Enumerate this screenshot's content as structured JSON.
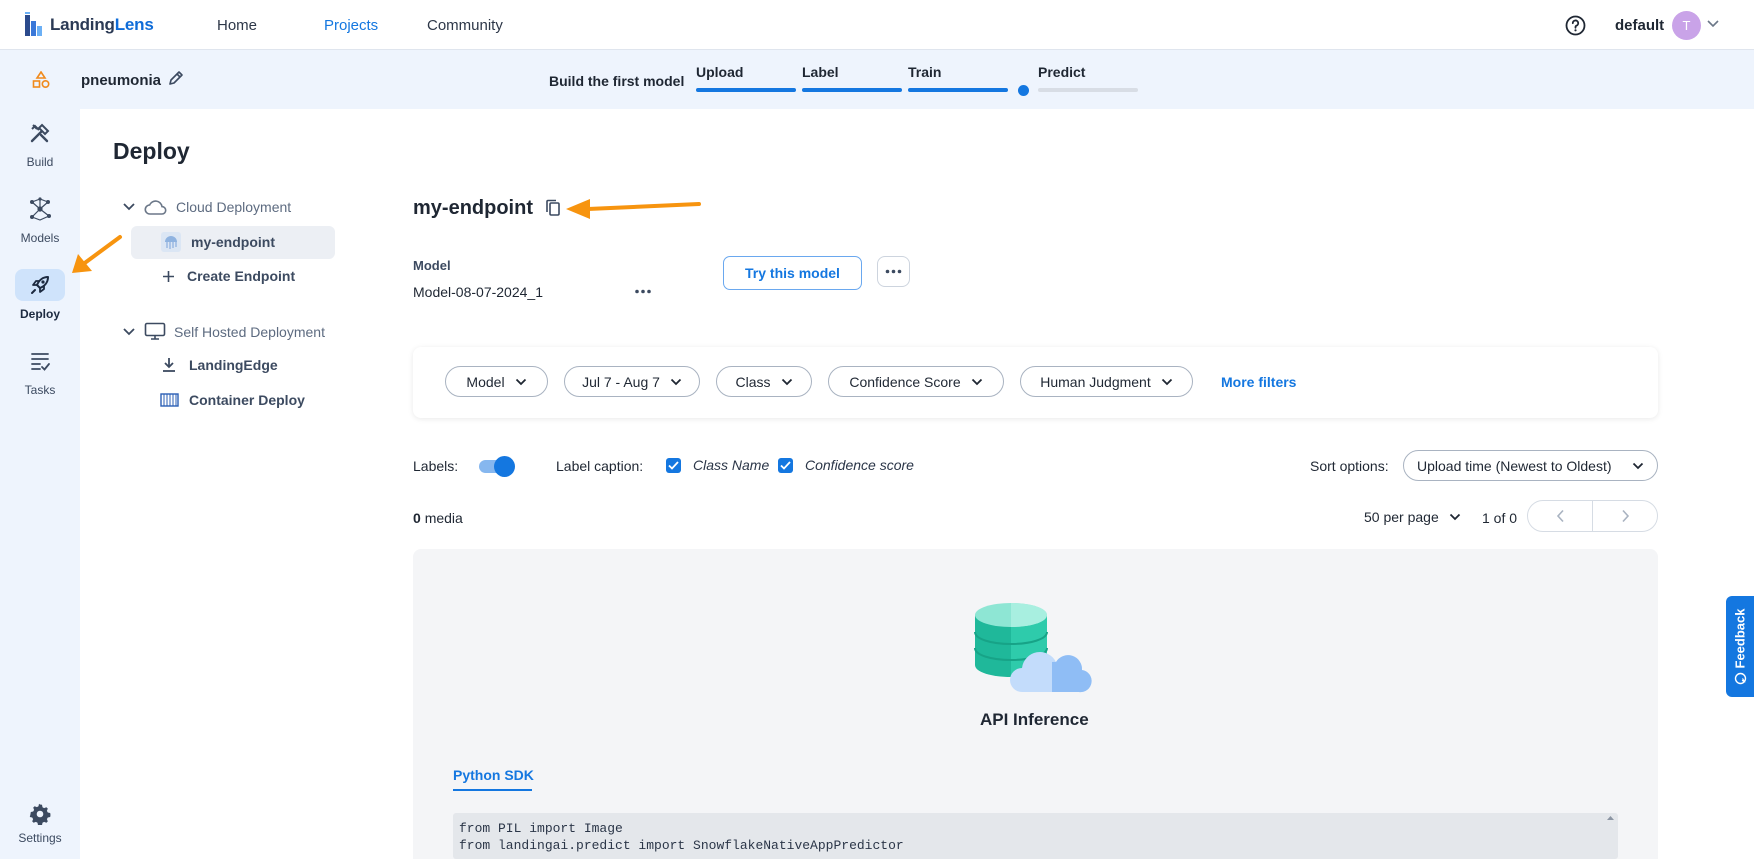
{
  "brand": {
    "name_part1": "Landing",
    "name_part2": "Lens"
  },
  "topnav": {
    "links": [
      {
        "label": "Home"
      },
      {
        "label": "Projects"
      },
      {
        "label": "Community"
      }
    ],
    "user": {
      "name": "default",
      "avatar_initial": "T"
    }
  },
  "project": {
    "name": "pneumonia",
    "progress_title": "Build the first model",
    "steps": [
      {
        "label": "Upload",
        "complete": true
      },
      {
        "label": "Label",
        "complete": true
      },
      {
        "label": "Train",
        "complete": true
      },
      {
        "label": "Predict",
        "complete": false
      }
    ]
  },
  "sidebar": {
    "items": [
      {
        "label": "Build",
        "icon": "tools-icon"
      },
      {
        "label": "Models",
        "icon": "network-icon"
      },
      {
        "label": "Deploy",
        "icon": "rocket-icon",
        "active": true
      },
      {
        "label": "Tasks",
        "icon": "tasks-list-icon"
      }
    ],
    "settings_label": "Settings"
  },
  "deploy": {
    "title": "Deploy",
    "tree": {
      "cloud_label": "Cloud Deployment",
      "endpoint_label": "my-endpoint",
      "create_label": "Create Endpoint",
      "self_hosted_label": "Self Hosted Deployment",
      "landingedge_label": "LandingEdge",
      "container_label": "Container Deploy"
    }
  },
  "endpoint": {
    "title": "my-endpoint",
    "model_label": "Model",
    "model_value": "Model-08-07-2024_1",
    "try_button": "Try this model"
  },
  "filters": {
    "chips": [
      {
        "label": "Model"
      },
      {
        "label": "Jul 7 - Aug 7"
      },
      {
        "label": "Class"
      },
      {
        "label": "Confidence Score"
      },
      {
        "label": "Human Judgment"
      }
    ],
    "more_label": "More filters"
  },
  "options": {
    "labels_text": "Labels:",
    "labels_on": true,
    "caption_text": "Label caption:",
    "caption_class": "Class Name",
    "caption_conf": "Confidence score",
    "sort_text": "Sort options:",
    "sort_value": "Upload time (Newest to Oldest)"
  },
  "media": {
    "count": "0",
    "count_suffix": "media",
    "per_page": "50 per page",
    "page_of": "1 of 0"
  },
  "api": {
    "title": "API Inference",
    "tab_label": "Python SDK",
    "code_line1": "from PIL import Image",
    "code_line2": "from landingai.predict import SnowflakeNativeAppPredictor"
  },
  "feedback_label": "Feedback",
  "colors": {
    "accent": "#1477e0",
    "annotation_arrow": "#f7940f"
  }
}
